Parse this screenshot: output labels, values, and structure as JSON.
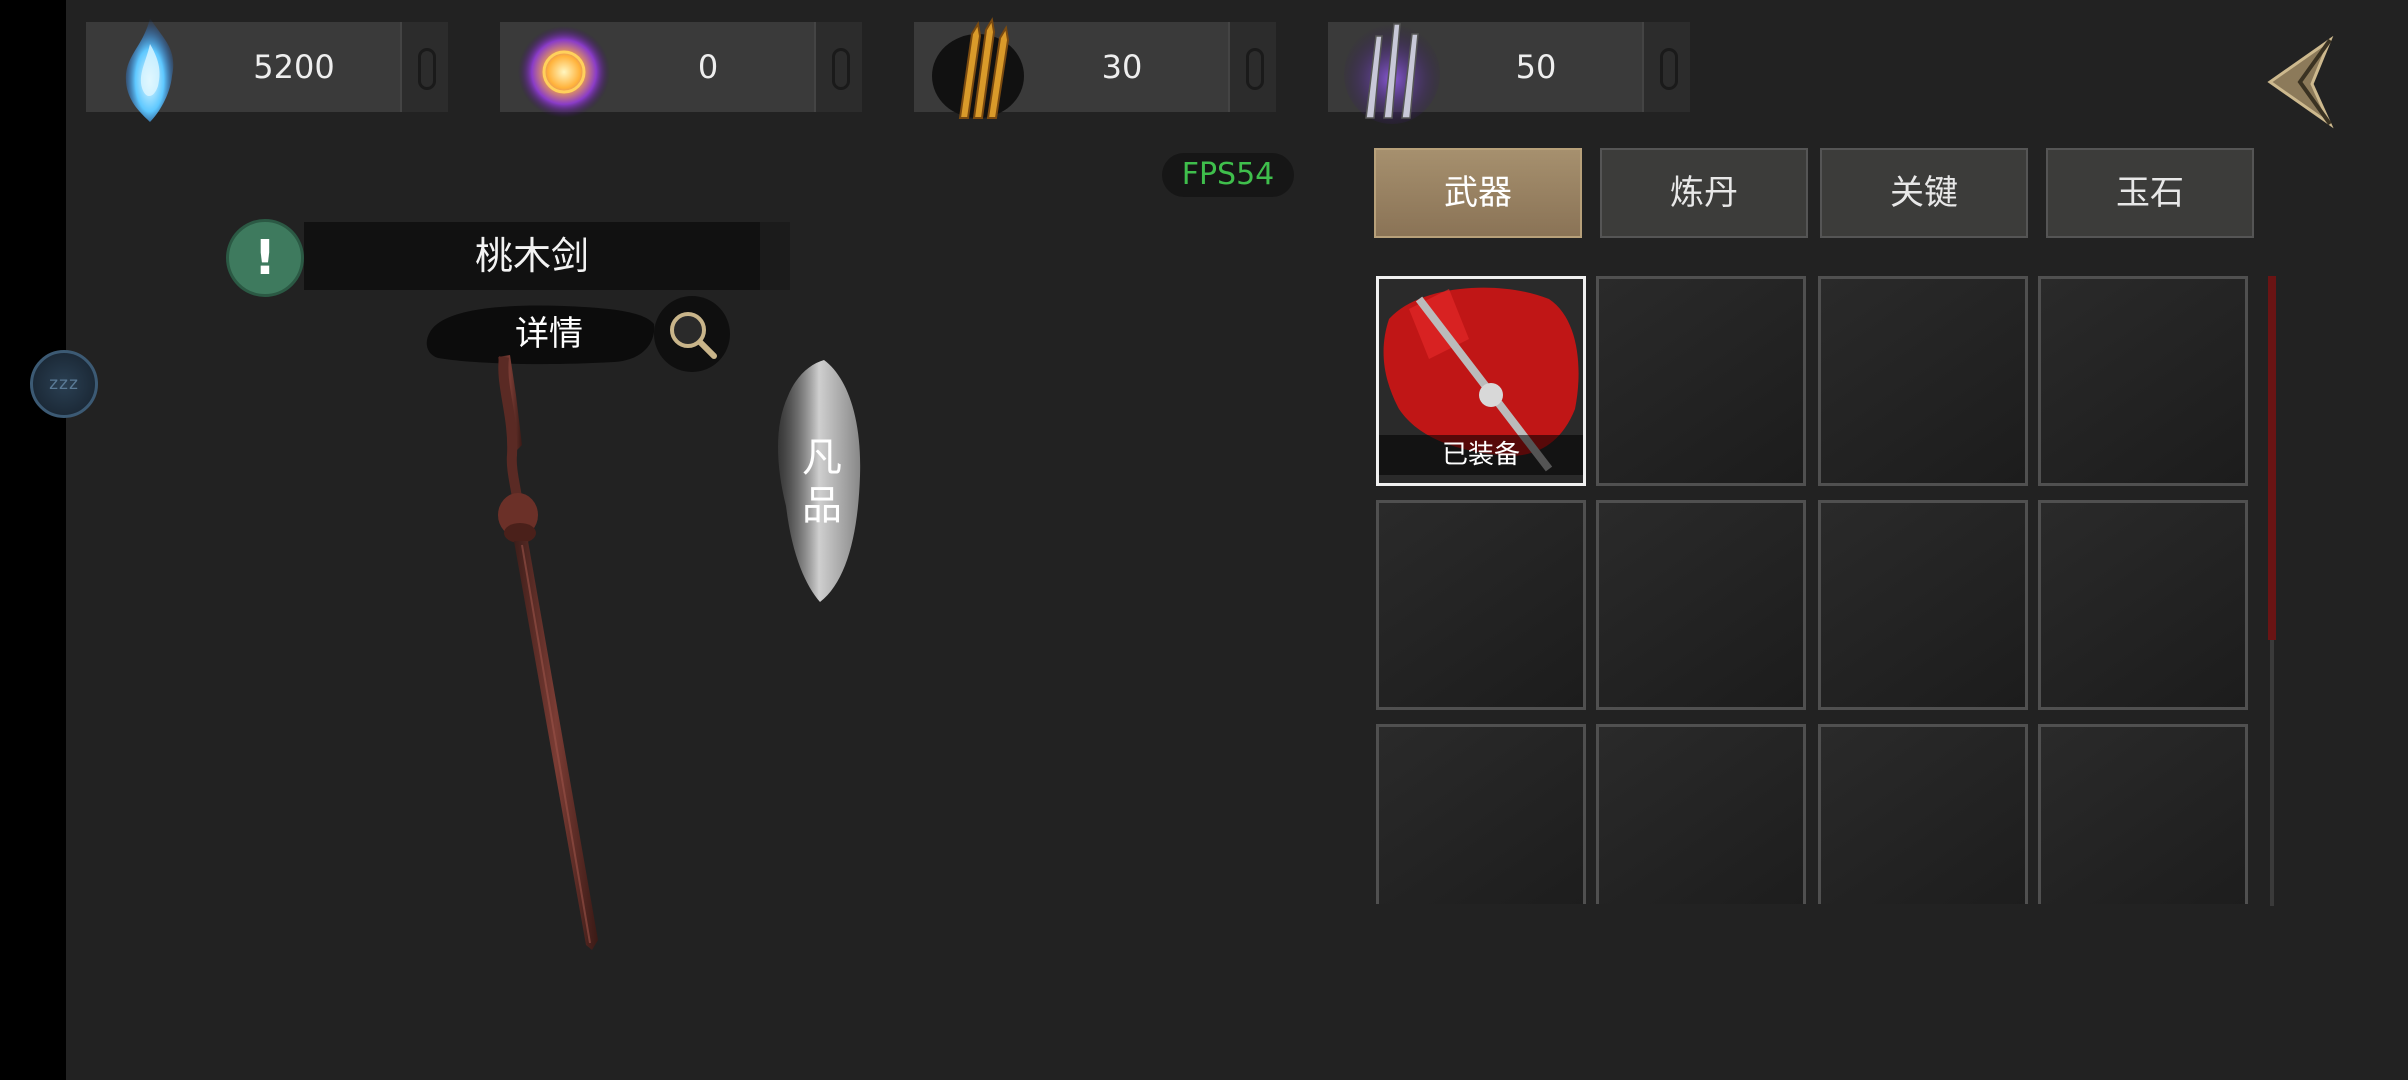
{
  "resources": [
    {
      "icon": "blue-flame-icon",
      "value": "5200"
    },
    {
      "icon": "golden-orb-icon",
      "value": "0"
    },
    {
      "icon": "golden-arrows-icon",
      "value": "30"
    },
    {
      "icon": "purple-blades-icon",
      "value": "50"
    }
  ],
  "fps": "FPS54",
  "sleep_label": "zzz",
  "item": {
    "name": "桃木剑",
    "detail_label": "详情",
    "grade": "凡品",
    "grade_line1": "凡",
    "grade_line2": "品"
  },
  "tabs": [
    {
      "label": "武器",
      "active": true
    },
    {
      "label": "炼丹",
      "active": false
    },
    {
      "label": "关键",
      "active": false
    },
    {
      "label": "玉石",
      "active": false
    }
  ],
  "inventory": {
    "equipped_label": "已装备",
    "slot_count": 12
  },
  "colors": {
    "background": "#222222",
    "fps_green": "#3fbf4c",
    "tab_active": "#a6906e",
    "alert_green": "#3e7a5e",
    "scroll_red": "#6a1414"
  }
}
